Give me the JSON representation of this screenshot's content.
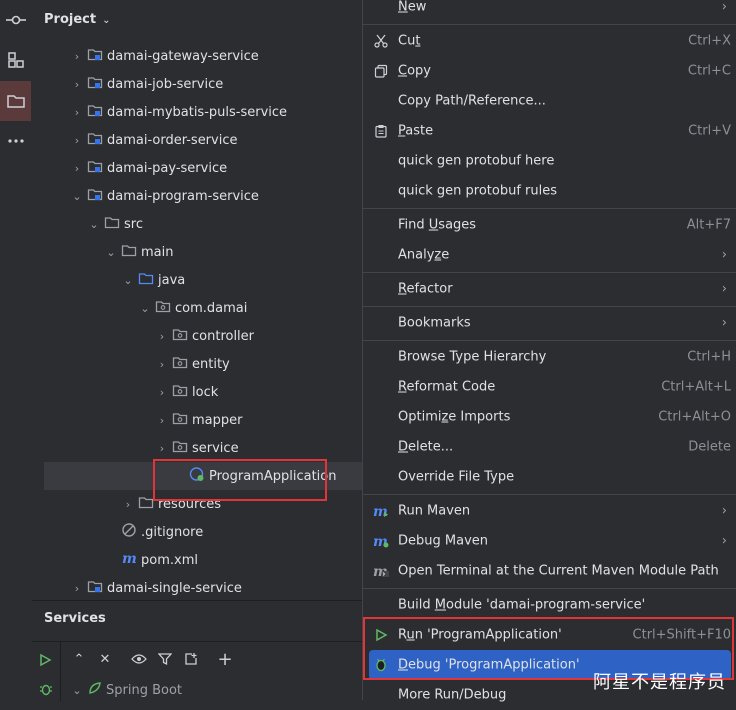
{
  "project": {
    "title": "Project",
    "tree": [
      {
        "label": "damai-gateway-service",
        "depth": 0,
        "arrow": "›",
        "icon": "module"
      },
      {
        "label": "damai-job-service",
        "depth": 0,
        "arrow": "›",
        "icon": "module"
      },
      {
        "label": "damai-mybatis-puls-service",
        "depth": 0,
        "arrow": "›",
        "icon": "module"
      },
      {
        "label": "damai-order-service",
        "depth": 0,
        "arrow": "›",
        "icon": "module"
      },
      {
        "label": "damai-pay-service",
        "depth": 0,
        "arrow": "›",
        "icon": "module"
      },
      {
        "label": "damai-program-service",
        "depth": 0,
        "arrow": "⌄",
        "icon": "module"
      },
      {
        "label": "src",
        "depth": 1,
        "arrow": "⌄",
        "icon": "folder"
      },
      {
        "label": "main",
        "depth": 2,
        "arrow": "⌄",
        "icon": "folder"
      },
      {
        "label": "java",
        "depth": 3,
        "arrow": "⌄",
        "icon": "src-folder"
      },
      {
        "label": "com.damai",
        "depth": 4,
        "arrow": "⌄",
        "icon": "package"
      },
      {
        "label": "controller",
        "depth": 5,
        "arrow": "›",
        "icon": "package"
      },
      {
        "label": "entity",
        "depth": 5,
        "arrow": "›",
        "icon": "package"
      },
      {
        "label": "lock",
        "depth": 5,
        "arrow": "›",
        "icon": "package"
      },
      {
        "label": "mapper",
        "depth": 5,
        "arrow": "›",
        "icon": "package"
      },
      {
        "label": "service",
        "depth": 5,
        "arrow": "›",
        "icon": "package"
      },
      {
        "label": "ProgramApplication",
        "depth": 6,
        "arrow": "",
        "icon": "spring-class",
        "selected": true
      },
      {
        "label": "resources",
        "depth": 3,
        "arrow": "›",
        "icon": "folder"
      },
      {
        "label": ".gitignore",
        "depth": 2,
        "arrow": "",
        "icon": "gitignore"
      },
      {
        "label": "pom.xml",
        "depth": 2,
        "arrow": "",
        "icon": "maven"
      },
      {
        "label": "damai-single-service",
        "depth": 0,
        "arrow": "›",
        "icon": "module"
      }
    ]
  },
  "services": {
    "title": "Services",
    "spring_boot": "Spring Boot"
  },
  "menu": {
    "items": [
      {
        "label": "New",
        "shortcut": "",
        "submenu": true,
        "icon": ""
      },
      {
        "sep": true
      },
      {
        "label": "Cut",
        "shortcut": "Ctrl+X",
        "icon": "scissors-icon"
      },
      {
        "label": "Copy",
        "shortcut": "Ctrl+C",
        "icon": "copy-icon"
      },
      {
        "label": "Copy Path/Reference...",
        "shortcut": "",
        "icon": ""
      },
      {
        "label": "Paste",
        "shortcut": "Ctrl+V",
        "icon": "paste-icon"
      },
      {
        "label": "quick gen protobuf here",
        "shortcut": "",
        "icon": ""
      },
      {
        "label": "quick gen protobuf rules",
        "shortcut": "",
        "icon": ""
      },
      {
        "sep": true
      },
      {
        "label": "Find Usages",
        "shortcut": "Alt+F7",
        "icon": ""
      },
      {
        "label": "Analyze",
        "shortcut": "",
        "submenu": true,
        "icon": ""
      },
      {
        "sep": true
      },
      {
        "label": "Refactor",
        "shortcut": "",
        "submenu": true,
        "icon": ""
      },
      {
        "sep": true
      },
      {
        "label": "Bookmarks",
        "shortcut": "",
        "submenu": true,
        "icon": ""
      },
      {
        "sep": true
      },
      {
        "label": "Browse Type Hierarchy",
        "shortcut": "Ctrl+H",
        "icon": ""
      },
      {
        "label": "Reformat Code",
        "shortcut": "Ctrl+Alt+L",
        "icon": ""
      },
      {
        "label": "Optimize Imports",
        "shortcut": "Ctrl+Alt+O",
        "icon": ""
      },
      {
        "label": "Delete...",
        "shortcut": "Delete",
        "icon": ""
      },
      {
        "label": "Override File Type",
        "shortcut": "",
        "icon": ""
      },
      {
        "sep": true
      },
      {
        "label": "Run Maven",
        "shortcut": "",
        "submenu": true,
        "icon": "maven-run-icon"
      },
      {
        "label": "Debug Maven",
        "shortcut": "",
        "submenu": true,
        "icon": "maven-debug-icon"
      },
      {
        "label": "Open Terminal at the Current Maven Module Path",
        "shortcut": "",
        "icon": "terminal-icon"
      },
      {
        "sep": true
      },
      {
        "label": "Build Module 'damai-program-service'",
        "shortcut": "",
        "icon": ""
      },
      {
        "label": "Run 'ProgramApplication'",
        "shortcut": "Ctrl+Shift+F10",
        "icon": "run-icon"
      },
      {
        "label": "Debug 'ProgramApplication'",
        "shortcut": "",
        "icon": "debug-icon",
        "highlighted": true
      },
      {
        "label": "More Run/Debug",
        "shortcut": "",
        "icon": ""
      }
    ]
  },
  "watermark": "阿星不是程序员",
  "colors": {
    "background": "#2b2d30",
    "highlight": "#2e62c5",
    "annotation_red": "#e0363a",
    "selected_row": "#393b40"
  }
}
